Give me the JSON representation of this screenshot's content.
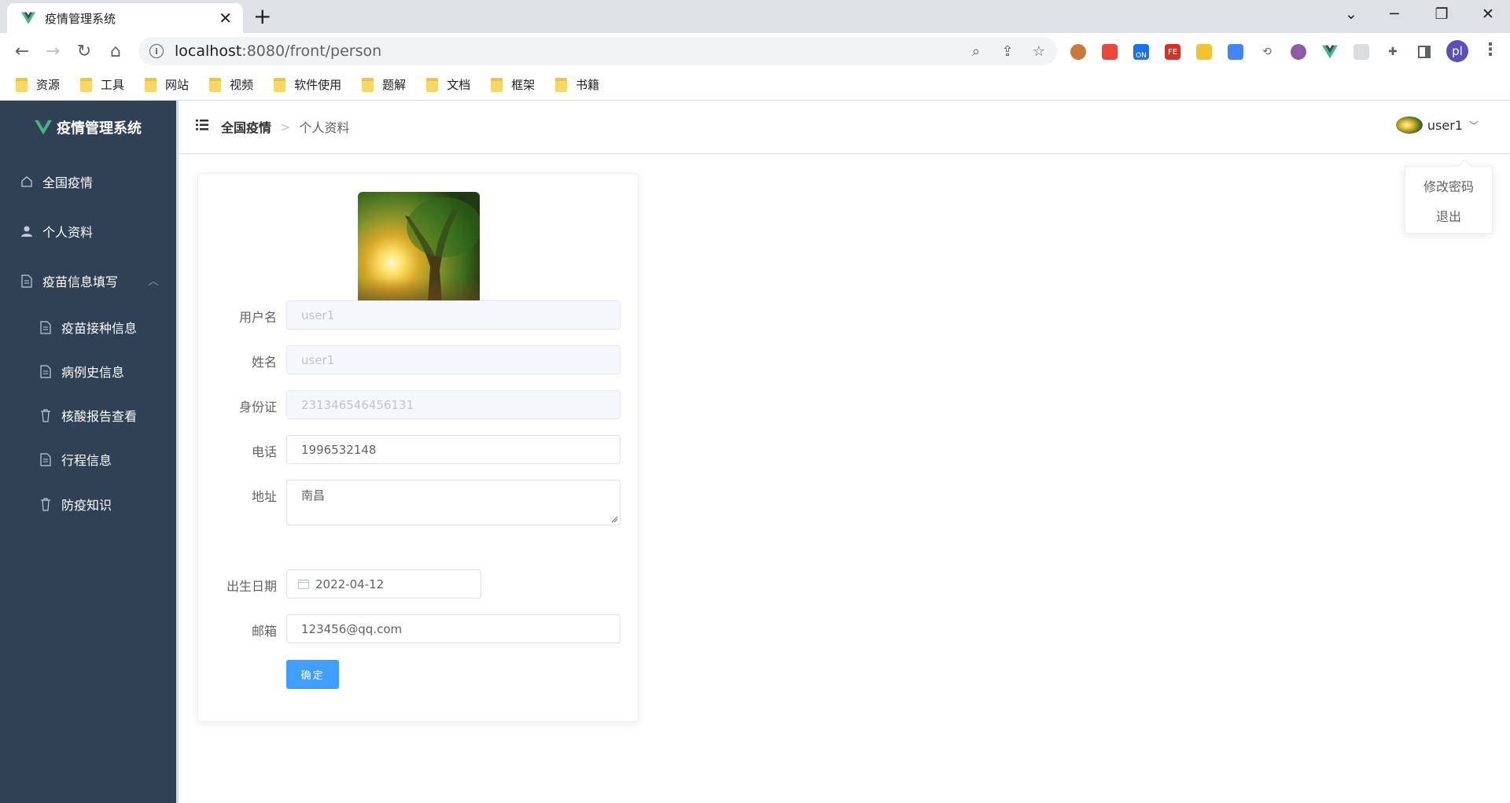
{
  "browser": {
    "tab_title": "疫情管理系统",
    "url_host": "localhost",
    "url_rest": ":8080/front/person",
    "profile_initials": "pl",
    "bookmarks": [
      "资源",
      "工具",
      "网站",
      "视频",
      "软件使用",
      "题解",
      "文档",
      "框架",
      "书籍"
    ],
    "extension_badge": "ON"
  },
  "sidebar": {
    "brand": "疫情管理系统",
    "items": [
      {
        "label": "全国疫情",
        "icon": "home-icon"
      },
      {
        "label": "个人资料",
        "icon": "user-icon"
      },
      {
        "label": "疫苗信息填写",
        "icon": "document-icon"
      },
      {
        "label": "疫苗接种信息",
        "icon": "document-icon"
      },
      {
        "label": "病例史信息",
        "icon": "document-icon"
      },
      {
        "label": "核酸报告查看",
        "icon": "trash-icon"
      },
      {
        "label": "行程信息",
        "icon": "document-icon"
      },
      {
        "label": "防疫知识",
        "icon": "trash-icon"
      }
    ]
  },
  "navbar": {
    "breadcrumb_root": "全国疫情",
    "breadcrumb_separator": ">",
    "breadcrumb_current": "个人资料",
    "username": "user1"
  },
  "user_menu": {
    "items": [
      "修改密码",
      "退出"
    ]
  },
  "form": {
    "username_label": "用户名",
    "username_value": "user1",
    "name_label": "姓名",
    "name_value": "user1",
    "idcard_label": "身份证",
    "idcard_value": "231346546456131",
    "phone_label": "电话",
    "phone_value": "1996532148",
    "address_label": "地址",
    "address_value": "南昌",
    "birthday_label": "出生日期",
    "birthday_value": "2022-04-12",
    "email_label": "邮箱",
    "email_value": "123456@qq.com",
    "submit_label": "确定"
  },
  "colors": {
    "sidebar_bg": "#304156",
    "primary": "#409eff",
    "vue_green": "#42b883"
  }
}
